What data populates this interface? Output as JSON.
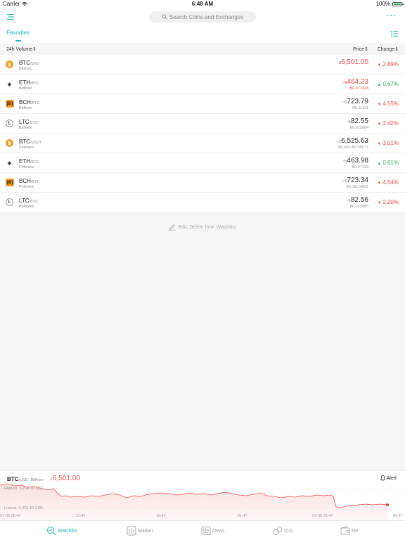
{
  "status": {
    "carrier": "Carrier",
    "time": "6:48 AM",
    "battery": "100%"
  },
  "search": {
    "placeholder": "Search Coins and Exchanges"
  },
  "tabs": {
    "favorites": "Favorites"
  },
  "headers": {
    "volume": "24h Volume",
    "price": "Price",
    "change": "Change"
  },
  "rows": [
    {
      "coin": "BTC",
      "quote": "/USD",
      "exchange": "Bitfinex",
      "cur": "$",
      "price": "6,501.00",
      "sub": "",
      "change": "2.89%",
      "dir": "down",
      "icon": "btc",
      "priceRed": true
    },
    {
      "coin": "ETH",
      "quote": "/BTC",
      "exchange": "Bitfinex",
      "cur": "≈$",
      "price": "464.23",
      "sub": "Ƀ0.071328",
      "change": "0.67%",
      "dir": "up",
      "icon": "eth",
      "priceRed": true
    },
    {
      "coin": "BCH",
      "quote": "/BTC",
      "exchange": "Bitfinex",
      "cur": "≈$",
      "price": "723.79",
      "sub": "Ƀ0.11131",
      "change": "4.55%",
      "dir": "down",
      "icon": "bch",
      "priceRed": false
    },
    {
      "coin": "LTC",
      "quote": "/BTC",
      "exchange": "Bitfinex",
      "cur": "≈$",
      "price": "82.55",
      "sub": "Ƀ0.012684",
      "change": "2.42%",
      "dir": "down",
      "icon": "ltc",
      "priceRed": false
    },
    {
      "coin": "BTC",
      "quote": "/USDT",
      "exchange": "Poloniex",
      "cur": "≈$",
      "price": "6,525.63",
      "sub": "₮6,493.48700077",
      "change": "3.01%",
      "dir": "down",
      "icon": "btc",
      "priceRed": false
    },
    {
      "coin": "ETH",
      "quote": "/BTC",
      "exchange": "Poloniex",
      "cur": "≈$",
      "price": "463.98",
      "sub": "Ƀ0.07129",
      "change": "0.61%",
      "dir": "up",
      "icon": "eth",
      "priceRed": false
    },
    {
      "coin": "BCH",
      "quote": "/BTC",
      "exchange": "Poloniex",
      "cur": "≈$",
      "price": "723.34",
      "sub": "Ƀ0.11114001",
      "change": "4.54%",
      "dir": "down",
      "icon": "bch",
      "priceRed": false
    },
    {
      "coin": "LTC",
      "quote": "/BTC",
      "exchange": "Poloniex",
      "cur": "≈$",
      "price": "82.56",
      "sub": "Ƀ0.012685",
      "change": "2.20%",
      "dir": "down",
      "icon": "ltc",
      "priceRed": false
    }
  ],
  "edit_label": "Edit, Delete from Watchlist",
  "chart": {
    "coin": "BTC",
    "quote": "/USD",
    "exchange": "Bitfinex",
    "price": "6,501.00",
    "alert": "Alert",
    "highest": "Highest: 6,704.70 USD",
    "lowest": "Lowest: 6,423.40 USD",
    "ticks": [
      "07-05 06:47",
      "11:47",
      "16:47",
      "21:47",
      "07-06 02:47",
      "06:47"
    ]
  },
  "colors": {
    "accent": "#1fb6b6",
    "down": "#f24b4b",
    "up": "#27ae60"
  },
  "tabbar": {
    "watchlist": "Watchlist",
    "market": "Market",
    "news": "News",
    "ico": "ICO",
    "me": "Me"
  }
}
